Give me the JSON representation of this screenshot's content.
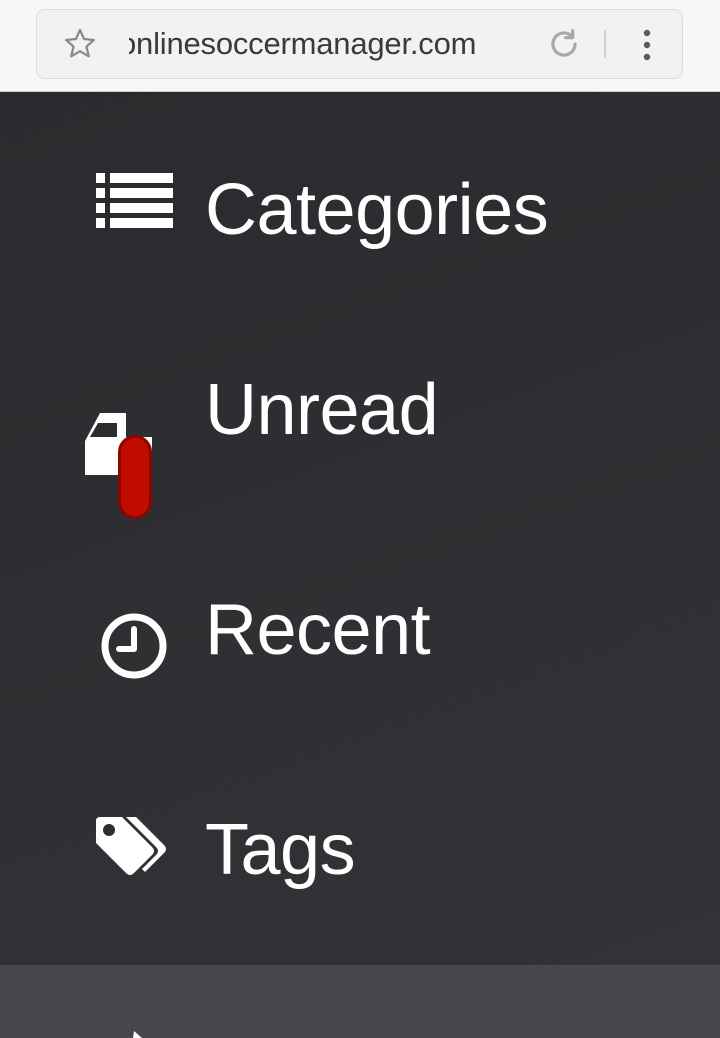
{
  "browser": {
    "url": "onlinesoccermanager.com",
    "icons": {
      "bookmark": "star-outline-icon",
      "reload": "reload-icon",
      "menu": "vertical-dots-icon"
    }
  },
  "menu": {
    "items": [
      {
        "label": "Categories",
        "icon": "list-icon"
      },
      {
        "label": "Unread",
        "icon": "inbox-icon"
      },
      {
        "label": "Recent",
        "icon": "clock-icon"
      },
      {
        "label": "Tags",
        "icon": "tags-icon"
      }
    ]
  },
  "colors": {
    "menu_background": "#2c2d30",
    "menu_text": "#ffffff",
    "unread_badge": "#c00c00",
    "lower_section": "#45474a",
    "chrome_background": "#f7f7f7"
  }
}
